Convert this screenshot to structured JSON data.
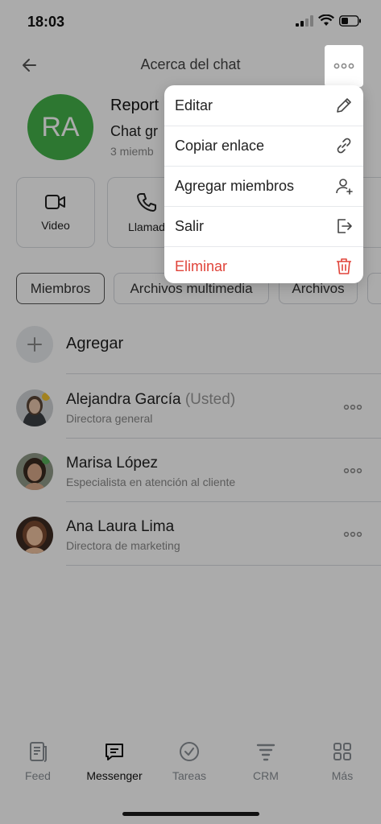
{
  "status_bar": {
    "time": "18:03"
  },
  "header": {
    "title": "Acerca del chat"
  },
  "chat": {
    "avatar_initials": "RA",
    "name": "Report",
    "type": "Chat gr",
    "members": "3 miemb"
  },
  "actions": [
    {
      "label": "Video",
      "icon": "video-icon"
    },
    {
      "label": "Llamad",
      "icon": "phone-icon"
    }
  ],
  "tabs": [
    {
      "label": "Miembros",
      "active": true
    },
    {
      "label": "Archivos multimedia",
      "active": false
    },
    {
      "label": "Archivos",
      "active": false
    }
  ],
  "add_label": "Agregar",
  "members": [
    {
      "name": "Alejandra García",
      "suffix": "(Usted)",
      "role": "Directora general"
    },
    {
      "name": "Marisa López",
      "suffix": "",
      "role": "Especialista en atención al cliente"
    },
    {
      "name": "Ana Laura Lima",
      "suffix": "",
      "role": "Directora de marketing"
    }
  ],
  "menu": [
    {
      "label": "Editar",
      "icon": "pencil-icon"
    },
    {
      "label": "Copiar enlace",
      "icon": "link-icon"
    },
    {
      "label": "Agregar miembros",
      "icon": "add-user-icon"
    },
    {
      "label": "Salir",
      "icon": "exit-icon"
    },
    {
      "label": "Eliminar",
      "icon": "trash-icon",
      "danger": true
    }
  ],
  "nav": [
    {
      "label": "Feed",
      "icon": "feed-icon",
      "active": false
    },
    {
      "label": "Messenger",
      "icon": "chat-icon",
      "active": true
    },
    {
      "label": "Tareas",
      "icon": "check-circle-icon",
      "active": false
    },
    {
      "label": "CRM",
      "icon": "funnel-icon",
      "active": false
    },
    {
      "label": "Más",
      "icon": "grid-icon",
      "active": false
    }
  ],
  "colors": {
    "avatar_green": "#43b24a",
    "danger": "#e0443a",
    "overlay": "rgba(0,0,0,0.33)"
  }
}
